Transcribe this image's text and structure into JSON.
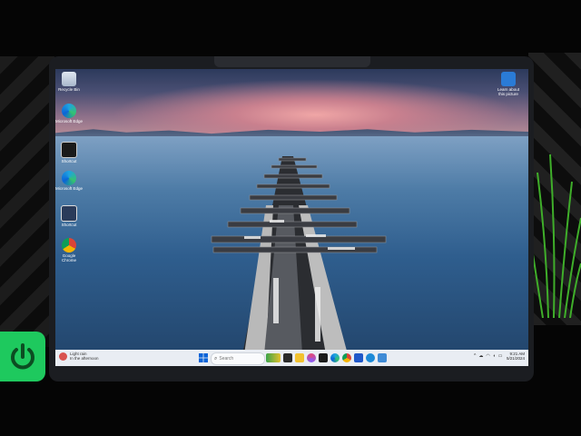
{
  "desktop": {
    "icons": [
      {
        "id": "recycle",
        "label": "Recycle Bin"
      },
      {
        "id": "edge1",
        "label": "Microsoft Edge"
      },
      {
        "id": "app1",
        "label": "Shortcut"
      },
      {
        "id": "edge2",
        "label": "Microsoft Edge"
      },
      {
        "id": "app2",
        "label": "Shortcut"
      },
      {
        "id": "chrome",
        "label": "Google Chrome"
      },
      {
        "id": "learn",
        "label": "Learn about this picture"
      }
    ]
  },
  "taskbar": {
    "weather_line1": "Light rain",
    "weather_line2": "In the afternoon",
    "search_placeholder": "Search",
    "time": "9:21 AM",
    "date": "5/21/2024"
  },
  "colors": {
    "taskbar_bg": "#e9edf3",
    "accent": "#0a64d8",
    "logo": "#1ec95e"
  }
}
